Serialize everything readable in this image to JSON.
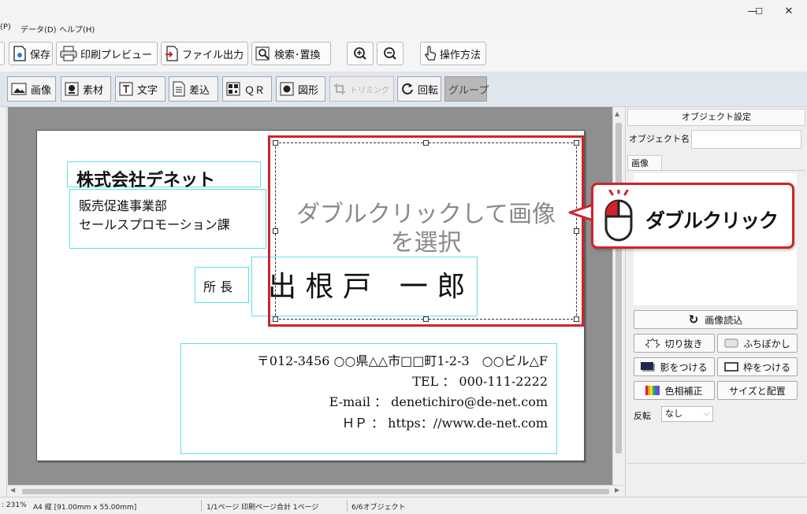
{
  "window": {
    "min_glyph": "—",
    "max_glyph": "☐",
    "close_glyph": "✕"
  },
  "menu": {
    "items": [
      "(P)",
      "データ(D)",
      "ヘルプ(H)"
    ]
  },
  "toolbar": {
    "save": "保存",
    "print_preview": "印刷プレビュー",
    "file_export": "ファイル出力",
    "search_replace": "検索･置換",
    "help": "操作方法"
  },
  "tools": {
    "image": "画像",
    "material": "素材",
    "text": "文字",
    "merge": "差込",
    "qr": "ＱＲ",
    "shape": "図形",
    "trim": "トリミング",
    "rotate": "回転",
    "group": "グループ"
  },
  "card": {
    "company": "株式会社デネット",
    "department": "販売促進事業部",
    "section": "セールスプロモーション課",
    "title": "所 長",
    "name": "出 根 戸　一 郎",
    "address": "〒012-3456 ○○県△△市□□町1-2-3　○○ビル△F",
    "tel": "TEL ： 000-111-2222",
    "email": "E-mail ： denetichiro@de-net.com",
    "hp": "ＨＰ ： https：//www.de-net.com",
    "image_placeholder_line1": "ダブルクリックして画像",
    "image_placeholder_line2": "を選択"
  },
  "callout": {
    "label": "ダブルクリック"
  },
  "panel": {
    "header": "オブジェクト設定",
    "object_name_label": "オブジェクト名",
    "object_name_value": "",
    "tab_image": "画像",
    "load_image": "画像読込",
    "crop": "切り抜き",
    "blur_edge": "ふちぼかし",
    "shadow": "影をつける",
    "border": "枠をつける",
    "color_correct": "色相補正",
    "size_position": "サイズと配置",
    "flip_label": "反転",
    "flip_value": "なし"
  },
  "status": {
    "zoom": ": 231%",
    "paper": "A4 縦 [91.00mm x 55.00mm]",
    "pages": "1/1ページ 印刷ページ合計 1ページ",
    "objects": "6/6オブジェクト"
  },
  "colors": {
    "accent_red": "#d0232a",
    "frame_cyan": "#5fe0e6",
    "canvas_gray": "#8f8f8f",
    "toolbar_blue": "#dfe6ee"
  }
}
